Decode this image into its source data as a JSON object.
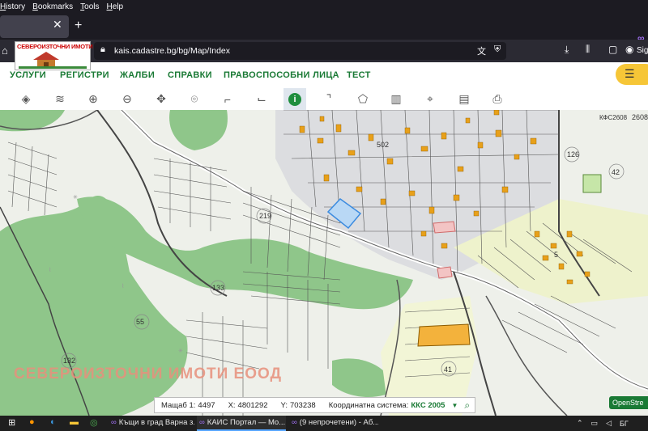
{
  "browser": {
    "menu": [
      "History",
      "Bookmarks",
      "Tools",
      "Help"
    ],
    "url": "kais.cadastre.bg/bg/Map/Index",
    "account_label": "Sig"
  },
  "logo_text": "СЕВЕРОИЗТОЧНИ ИМОТИ",
  "site_nav": [
    "УСЛУГИ",
    "РЕГИСТРИ",
    "ЖАЛБИ",
    "СПРАВКИ",
    "ПРАВОСПОСОБНИ ЛИЦА",
    "ТЕСТ"
  ],
  "map": {
    "labels": [
      "2608",
      "502",
      "126",
      "42",
      "219",
      "5",
      "133",
      "55",
      "132",
      "41",
      "КФС2608"
    ],
    "watermark": "СЕВЕРОИЗТОЧНИ ИМОТИ ЕООД"
  },
  "status": {
    "scale_label": "Мащаб 1:",
    "scale_value": "4497",
    "x_label": "X:",
    "x_value": "4801292",
    "y_label": "Y:",
    "y_value": "703238",
    "crs_label": "Координатна система:",
    "crs_value": "ККС 2005"
  },
  "osm_label": "OpenStre",
  "taskbar": {
    "tasks": [
      "Къщи в град Варна з...",
      "КАИС Портал — Mo...",
      "(9 непрочетени) - Аб..."
    ],
    "lang": "БГ"
  },
  "colors": {
    "site_green": "#1a7a35",
    "forest": "#8fc68a",
    "parcel_orange": "#e8a01a",
    "highlight_blue": "#3b8be0",
    "pill_yellow": "#f6c637"
  }
}
